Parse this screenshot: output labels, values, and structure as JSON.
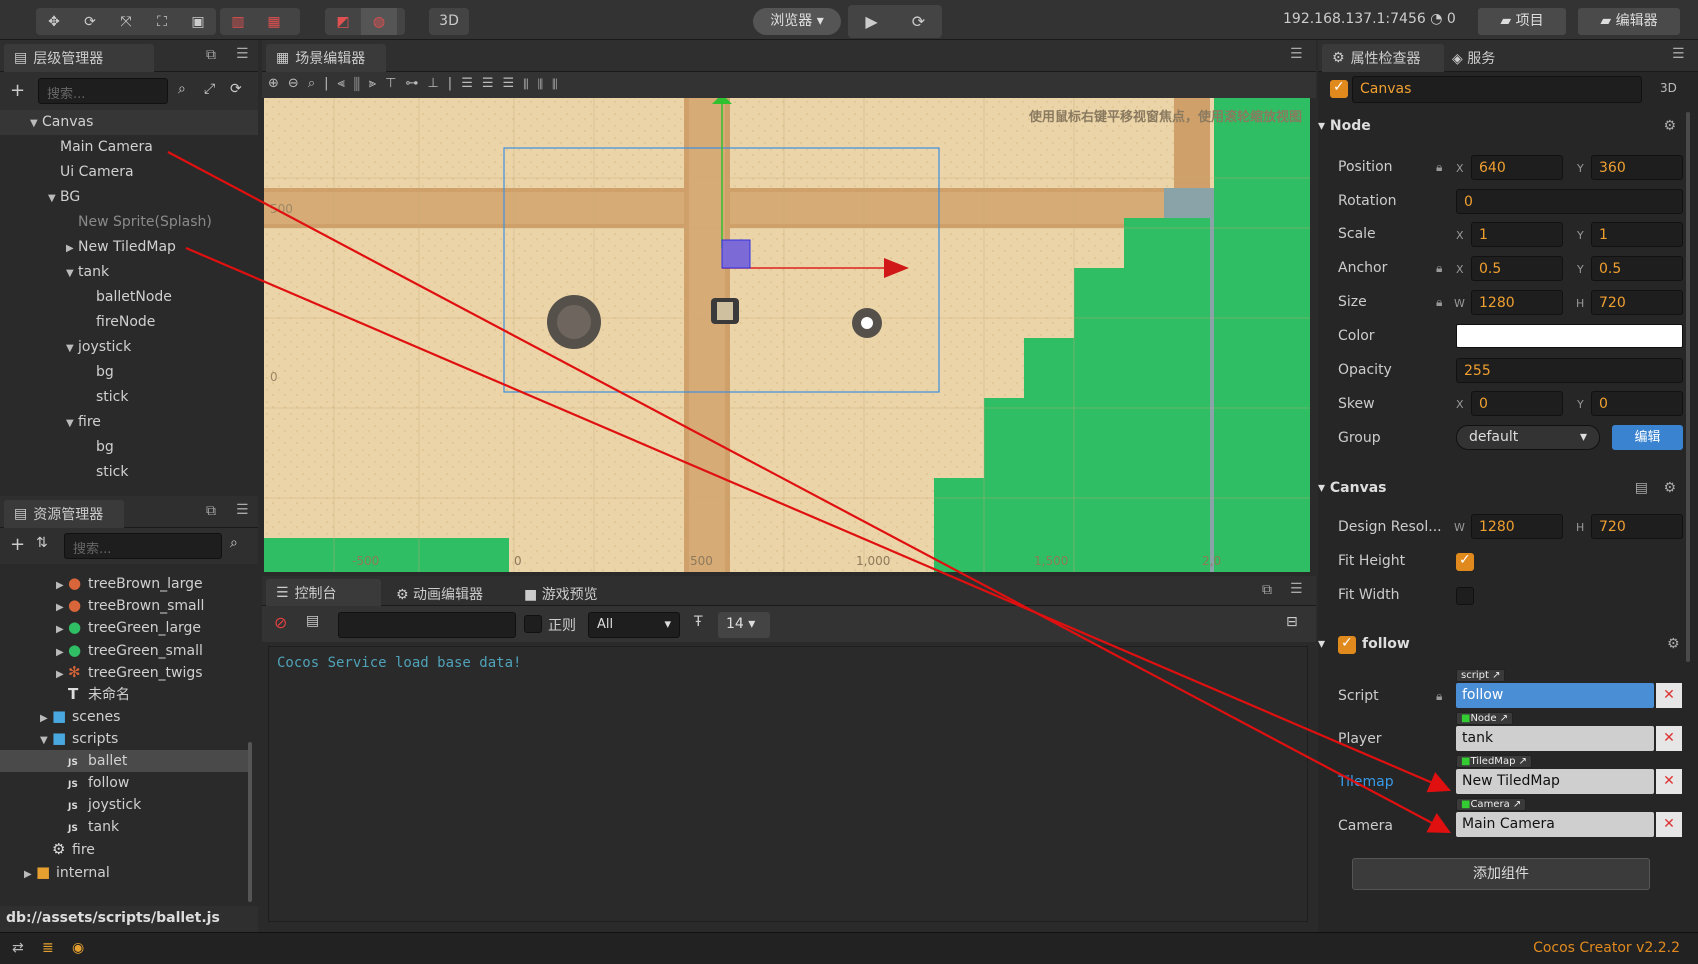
{
  "toolbar": {
    "btn3d": "3D",
    "browser_label": "浏览器",
    "ip_address": "192.168.137.1:7456",
    "connections": "0",
    "project_button": "项目",
    "editor_button": "编辑器"
  },
  "hierarchy": {
    "tab_label": "层级管理器",
    "search_placeholder": "搜索...",
    "nodes": [
      {
        "label": "Canvas",
        "depth": 0,
        "expander": "open",
        "dim": false
      },
      {
        "label": "Main Camera",
        "depth": 1,
        "expander": "none",
        "dim": false
      },
      {
        "label": "Ui Camera",
        "depth": 1,
        "expander": "none",
        "dim": false
      },
      {
        "label": "BG",
        "depth": 1,
        "expander": "open",
        "dim": false
      },
      {
        "label": "New Sprite(Splash)",
        "depth": 2,
        "expander": "none",
        "dim": true
      },
      {
        "label": "New TiledMap",
        "depth": 2,
        "expander": "closed",
        "dim": false
      },
      {
        "label": "tank",
        "depth": 2,
        "expander": "open",
        "dim": false
      },
      {
        "label": "balletNode",
        "depth": 3,
        "expander": "none",
        "dim": false
      },
      {
        "label": "fireNode",
        "depth": 3,
        "expander": "none",
        "dim": false
      },
      {
        "label": "joystick",
        "depth": 2,
        "expander": "open",
        "dim": false
      },
      {
        "label": "bg",
        "depth": 3,
        "expander": "none",
        "dim": false
      },
      {
        "label": "stick",
        "depth": 3,
        "expander": "none",
        "dim": false
      },
      {
        "label": "fire",
        "depth": 2,
        "expander": "open",
        "dim": false
      },
      {
        "label": "bg",
        "depth": 3,
        "expander": "none",
        "dim": false
      },
      {
        "label": "stick",
        "depth": 3,
        "expander": "none",
        "dim": false
      }
    ]
  },
  "assets": {
    "tab_label": "资源管理器",
    "search_placeholder": "搜索...",
    "items": [
      {
        "label": "treeBrown_large",
        "icon": "tree-brown-icon",
        "indent": 3,
        "expander": "closed"
      },
      {
        "label": "treeBrown_small",
        "icon": "tree-brown-icon",
        "indent": 3,
        "expander": "closed"
      },
      {
        "label": "treeGreen_large",
        "icon": "tree-green-icon",
        "indent": 3,
        "expander": "closed"
      },
      {
        "label": "treeGreen_small",
        "icon": "tree-green-icon",
        "indent": 3,
        "expander": "closed"
      },
      {
        "label": "treeGreen_twigs",
        "icon": "twigs-icon",
        "indent": 3,
        "expander": "closed"
      },
      {
        "label": "未命名",
        "icon": "font-icon",
        "indent": 3,
        "expander": "none"
      },
      {
        "label": "scenes",
        "icon": "folder-icon",
        "indent": 2,
        "expander": "closed"
      },
      {
        "label": "scripts",
        "icon": "folder-icon",
        "indent": 2,
        "expander": "open"
      },
      {
        "label": "ballet",
        "icon": "js-file-icon",
        "indent": 3,
        "expander": "none",
        "selected": true
      },
      {
        "label": "follow",
        "icon": "js-file-icon",
        "indent": 3,
        "expander": "none"
      },
      {
        "label": "joystick",
        "icon": "js-file-icon",
        "indent": 3,
        "expander": "none"
      },
      {
        "label": "tank",
        "icon": "js-file-icon",
        "indent": 3,
        "expander": "none"
      },
      {
        "label": "fire",
        "icon": "animation-icon",
        "indent": 2,
        "expander": "none"
      },
      {
        "label": "internal",
        "icon": "lock-folder-icon",
        "indent": 1,
        "expander": "closed"
      }
    ],
    "path": "db://assets/scripts/ballet.js"
  },
  "scene": {
    "tab_label": "场景编辑器",
    "hint": "使用鼠标右键平移视窗焦点，使用滚轮缩放视图",
    "ruler_x": [
      "-500",
      "0",
      "500",
      "1,000",
      "1,500",
      "2,0"
    ],
    "ruler_y": [
      "500",
      "0"
    ]
  },
  "console": {
    "tab_label": "控制台",
    "tab_anim": "动画编辑器",
    "tab_preview": "游戏预览",
    "regex_label": "正则",
    "level_select": "All",
    "font_size": "14",
    "log_text": "Cocos Service load base data!"
  },
  "inspector": {
    "tab_label": "属性检查器",
    "tab_services": "服务",
    "node_name": "Canvas",
    "mode_3d": "3D",
    "node_section": "Node",
    "position_label": "Position",
    "pos_x": "640",
    "pos_y": "360",
    "rotation_label": "Rotation",
    "rotation": "0",
    "scale_label": "Scale",
    "scale_x": "1",
    "scale_y": "1",
    "anchor_label": "Anchor",
    "anchor_x": "0.5",
    "anchor_y": "0.5",
    "size_label": "Size",
    "size_w": "1280",
    "size_h": "720",
    "color_label": "Color",
    "color_value": "#ffffff",
    "opacity_label": "Opacity",
    "opacity": "255",
    "skew_label": "Skew",
    "skew_x": "0",
    "skew_y": "0",
    "group_label": "Group",
    "group_value": "default",
    "group_edit": "编辑",
    "canvas_section": "Canvas",
    "design_label": "Design Resol...",
    "design_w": "1280",
    "design_h": "720",
    "fit_height_label": "Fit Height",
    "fit_height": true,
    "fit_width_label": "Fit Width",
    "fit_width": false,
    "follow_section": "follow",
    "script_label": "Script",
    "script_tag": "script",
    "script_value": "follow",
    "player_label": "Player",
    "player_tag": "Node",
    "player_value": "tank",
    "tilemap_label": "Tilemap",
    "tilemap_tag": "TiledMap",
    "tilemap_value": "New TiledMap",
    "camera_label": "Camera",
    "camera_tag": "Camera",
    "camera_value": "Main Camera",
    "add_component": "添加组件",
    "axis_x": "X",
    "axis_y": "Y",
    "axis_w": "W",
    "axis_h": "H"
  },
  "statusbar": {
    "version": "Cocos Creator v2.2.2"
  },
  "colors": {
    "accent": "#e08a1e",
    "selection_blue": "#4a8fd6",
    "annotation_red": "#e01010",
    "sand": "#e8cfa0",
    "road": "#c99a62",
    "grass": "#2fbe63"
  }
}
